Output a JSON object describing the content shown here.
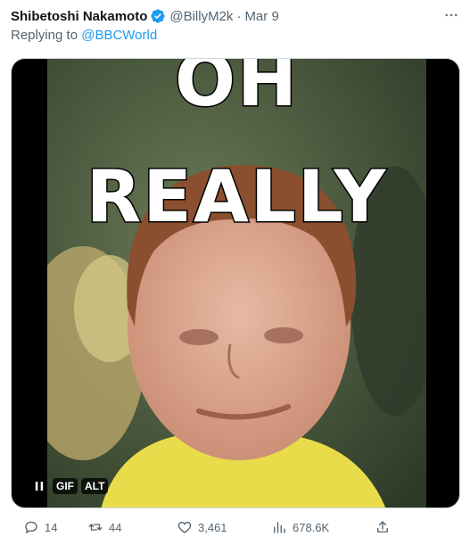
{
  "tweet": {
    "author_name": "Shibetoshi Nakamoto",
    "handle": "@BillyM2k",
    "separator": "·",
    "date": "Mar 9",
    "replying_prefix": "Replying to",
    "replying_to": "@BBCWorld"
  },
  "media": {
    "overlay_line_1": "OH",
    "overlay_line_2": "REALLY",
    "gif_badge": "GIF",
    "alt_badge": "ALT",
    "pause_icon": "pause-icon"
  },
  "actions": {
    "replies": "14",
    "retweets": "44",
    "likes": "3,461",
    "views": "678.6K"
  },
  "colors": {
    "accent": "#1d9bf0",
    "muted": "#536471",
    "text": "#0f1419"
  }
}
